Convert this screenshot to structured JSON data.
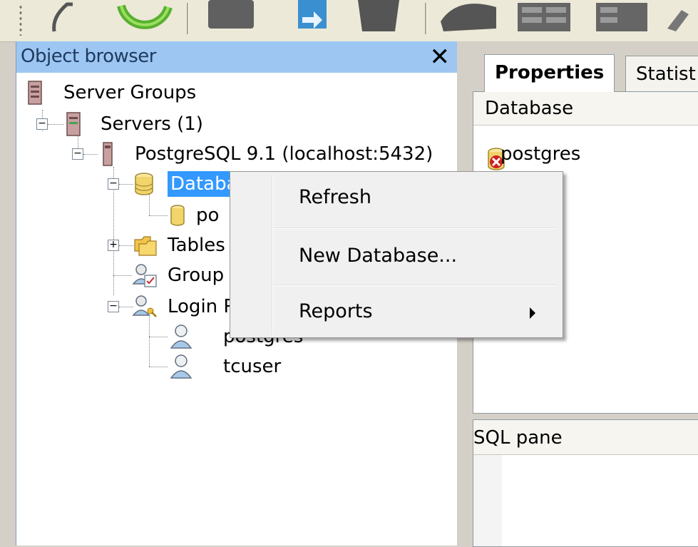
{
  "object_browser": {
    "title": "Object browser",
    "close_glyph": "✕",
    "tree": {
      "server_groups": "Server Groups",
      "servers": "Servers (1)",
      "server": "PostgreSQL 9.1 (localhost:5432)",
      "databases": "Databa",
      "database_postgres": "po",
      "tablespaces": "Tables",
      "group_roles": "Group",
      "login_roles": "Login R",
      "login_postgres": "postgres",
      "login_tcuser": "tcuser"
    }
  },
  "context_menu": {
    "items": [
      {
        "label": "Refresh"
      },
      {
        "label": "New Database..."
      },
      {
        "label": "Reports",
        "has_submenu": true
      }
    ]
  },
  "right_panel": {
    "tabs": [
      "Properties",
      "Statist"
    ],
    "properties_column": "Database",
    "properties_rows": [
      "postgres"
    ],
    "sql_pane_title": "SQL pane"
  },
  "colors": {
    "title_bar": "#9dc6f2",
    "selection": "#3399ff",
    "menu_bg": "#f0f0f0"
  },
  "icons": [
    "server-group-icon",
    "server-icon",
    "postgresql-server-icon",
    "databases-icon",
    "database-icon",
    "tablespaces-icon",
    "group-roles-icon",
    "login-roles-icon",
    "user-icon",
    "database-error-icon",
    "refresh-icon",
    "submenu-arrow-icon"
  ]
}
